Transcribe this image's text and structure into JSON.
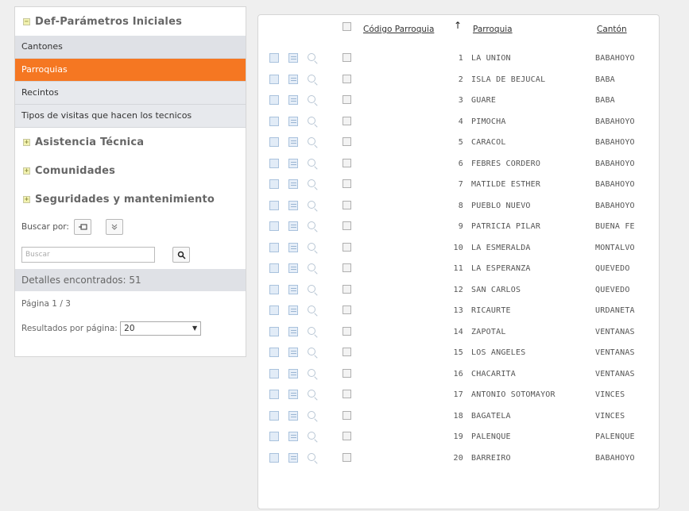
{
  "sidebar": {
    "section_main": "Def-Parámetros Iniciales",
    "items": [
      {
        "label": "Cantones",
        "active": false
      },
      {
        "label": "Parroquias",
        "active": true
      },
      {
        "label": "Recintos",
        "active": false
      },
      {
        "label": "Tipos de visitas que hacen los tecnicos",
        "active": false
      }
    ],
    "sections": [
      "Asistencia Técnica",
      "Comunidades",
      "Seguridades y mantenimiento"
    ],
    "search_label": "Buscar por:",
    "search_placeholder": "Buscar",
    "details": "Detalles encontrados: 51",
    "page": "Página 1 / 3",
    "per_page_label": "Resultados por página:",
    "per_page_value": "20"
  },
  "table": {
    "headers": {
      "code": "Código Parroquia",
      "parish": "Parroquia",
      "canton": "Cantón"
    },
    "rows": [
      {
        "code": "1",
        "parish": "LA UNION",
        "canton": "BABAHOYO"
      },
      {
        "code": "2",
        "parish": "ISLA DE BEJUCAL",
        "canton": "BABA"
      },
      {
        "code": "3",
        "parish": "GUARE",
        "canton": "BABA"
      },
      {
        "code": "4",
        "parish": "PIMOCHA",
        "canton": "BABAHOYO"
      },
      {
        "code": "5",
        "parish": "CARACOL",
        "canton": "BABAHOYO"
      },
      {
        "code": "6",
        "parish": "FEBRES CORDERO",
        "canton": "BABAHOYO"
      },
      {
        "code": "7",
        "parish": "MATILDE ESTHER",
        "canton": "BABAHOYO"
      },
      {
        "code": "8",
        "parish": "PUEBLO NUEVO",
        "canton": "BABAHOYO"
      },
      {
        "code": "9",
        "parish": "PATRICIA PILAR",
        "canton": "BUENA FE"
      },
      {
        "code": "10",
        "parish": "LA ESMERALDA",
        "canton": "MONTALVO"
      },
      {
        "code": "11",
        "parish": "LA ESPERANZA",
        "canton": "QUEVEDO"
      },
      {
        "code": "12",
        "parish": "SAN CARLOS",
        "canton": "QUEVEDO"
      },
      {
        "code": "13",
        "parish": "RICAURTE",
        "canton": "URDANETA"
      },
      {
        "code": "14",
        "parish": "ZAPOTAL",
        "canton": "VENTANAS"
      },
      {
        "code": "15",
        "parish": "LOS ANGELES",
        "canton": "VENTANAS"
      },
      {
        "code": "16",
        "parish": "CHACARITA",
        "canton": "VENTANAS"
      },
      {
        "code": "17",
        "parish": "ANTONIO SOTOMAYOR",
        "canton": "VINCES"
      },
      {
        "code": "18",
        "parish": "BAGATELA",
        "canton": "VINCES"
      },
      {
        "code": "19",
        "parish": "PALENQUE",
        "canton": "PALENQUE"
      },
      {
        "code": "20",
        "parish": "BARREIRO",
        "canton": "BABAHOYO"
      }
    ]
  }
}
